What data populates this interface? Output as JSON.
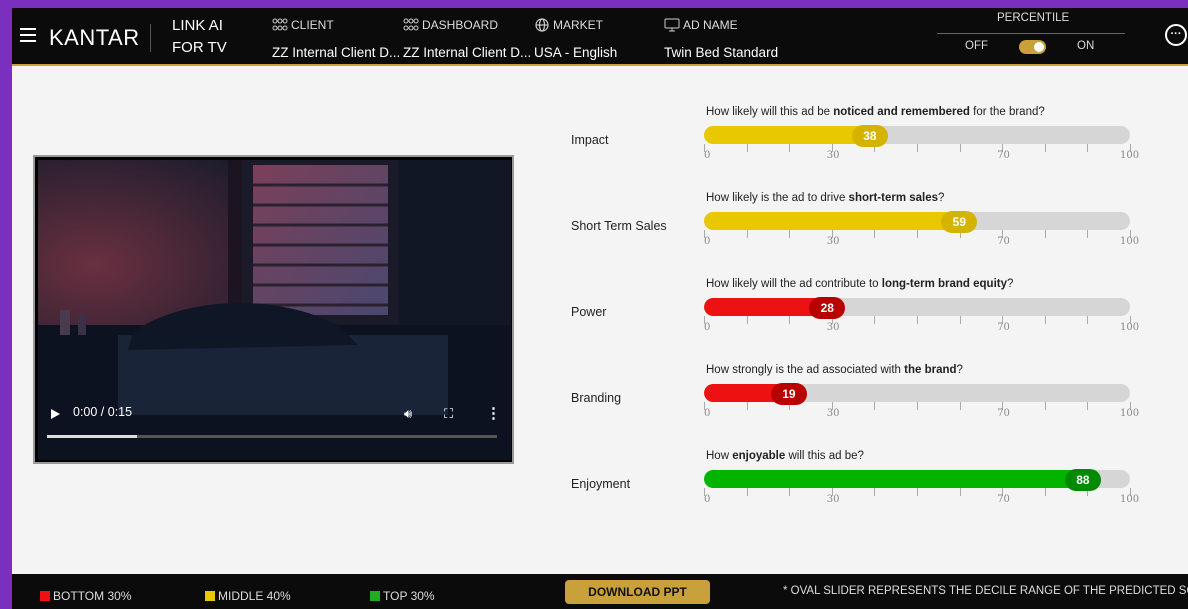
{
  "header": {
    "brand": "KANTAR",
    "app_title_line1": "LINK AI",
    "app_title_line2": "FOR TV",
    "client_label": "CLIENT",
    "client_value": "ZZ Internal Client D...",
    "dashboard_label": "DASHBOARD",
    "dashboard_value": "ZZ Internal Client D...",
    "market_label": "MARKET",
    "market_value": "USA - English",
    "ad_name_label": "AD NAME",
    "ad_name_value": "Twin Bed Standard",
    "percentile_label": "PERCENTILE",
    "percentile_off": "OFF",
    "percentile_on": "ON",
    "more_icon": "ellipsis-circle-icon"
  },
  "video": {
    "time": "0:00 / 0:15",
    "progress_fraction": 0.2
  },
  "metrics": [
    {
      "label": "Impact",
      "q_pre": "How likely will this ad be ",
      "q_bold": "noticed and remembered",
      "q_post": " for the brand?",
      "score": "38",
      "value": 38,
      "color": "#e8c800",
      "oval": "#d4b400"
    },
    {
      "label": "Short Term Sales",
      "q_pre": "How likely is the ad to drive ",
      "q_bold": "short-term sales",
      "q_post": "?",
      "score": "59",
      "value": 59,
      "color": "#e8c800",
      "oval": "#d4b400"
    },
    {
      "label": "Power",
      "q_pre": "How likely will the ad contribute to ",
      "q_bold": "long-term brand equity",
      "q_post": "?",
      "score": "28",
      "value": 28,
      "color": "#ee1111",
      "oval": "#b80000"
    },
    {
      "label": "Branding",
      "q_pre": "How strongly is the ad associated with ",
      "q_bold": "the brand",
      "q_post": "?",
      "score": "19",
      "value": 19,
      "color": "#ee1111",
      "oval": "#b80000"
    },
    {
      "label": "Enjoyment",
      "q_pre": "How ",
      "q_bold": "enjoyable",
      "q_post": " will this ad be?",
      "score": "88",
      "value": 88,
      "color": "#00b400",
      "oval": "#008a00"
    }
  ],
  "scale": {
    "min": "0",
    "mid1": "30",
    "mid2": "70",
    "max": "100"
  },
  "footer": {
    "bottom_label": "BOTTOM 30%",
    "bottom_color": "#ee1111",
    "middle_label": "MIDDLE 40%",
    "middle_color": "#e8c800",
    "top_label": "TOP 30%",
    "top_color": "#22aa22",
    "download_label": "DOWNLOAD PPT",
    "note": "* OVAL SLIDER REPRESENTS THE DECILE RANGE OF THE PREDICTED SCORE"
  }
}
